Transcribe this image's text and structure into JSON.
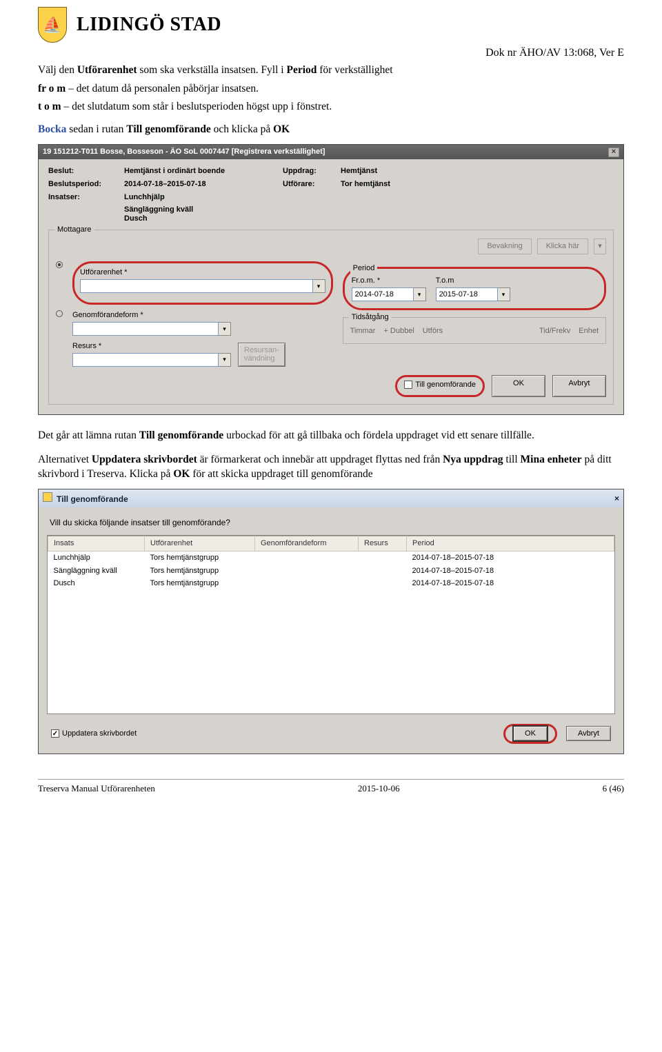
{
  "header": {
    "org": "LIDINGÖ STAD"
  },
  "docref": "Dok nr ÄHO/AV 13:068, Ver E",
  "intro": {
    "t1a": "Välj den ",
    "t1b": "Utförarenhet",
    "t1c": " som ska verkställa insatsen. Fyll i ",
    "t1d": "Period",
    "t1e": " för verkställighet",
    "t2a": "fr o m",
    "t2b": " – det datum då personalen påbörjar insatsen.",
    "t3a": "t o m",
    "t3b": " – det slutdatum som står i beslutsperioden högst upp i fönstret.",
    "t4a": "Bocka",
    "t4b": " sedan i rutan ",
    "t4c": "Till genomförande",
    "t4d": " och klicka på ",
    "t4e": "OK"
  },
  "win1": {
    "title": "19 151212-T011   Bosse, Bosseson   -   ÄO SoL   0007447   [Registrera verkställighet]",
    "labels": {
      "beslut": "Beslut:",
      "beslut_val": "Hemtjänst i ordinärt boende",
      "uppdrag": "Uppdrag:",
      "uppdrag_val": "Hemtjänst",
      "period": "Beslutsperiod:",
      "period_val": "2014-07-18–2015-07-18",
      "utforare": "Utförare:",
      "utforare_val": "Tor hemtjänst",
      "insatser": "Insatser:"
    },
    "insats_list": [
      "Lunchhjälp",
      "Sängläggning kväll",
      "Dusch"
    ],
    "group_mottagare": "Mottagare",
    "bevakning": "Bevakning",
    "klicka_har": "Klicka här",
    "utforarenhet": "Utförarenhet *",
    "genomform": "Genomförandeform *",
    "resurs": "Resurs *",
    "resursan": "Resursan-\nvändning",
    "group_period": "Period",
    "from": "Fr.o.m. *",
    "tom": "T.o.m",
    "from_val": "2014-07-18",
    "tom_val": "2015-07-18",
    "group_tids": "Tidsåtgång",
    "tids_cols": {
      "timmar": "Timmar",
      "dubbel": "+ Dubbel",
      "utfors": "Utförs",
      "tidfrekv": "Tid/Frekv",
      "enhet": "Enhet"
    },
    "till_genom": "Till genomförande",
    "ok": "OK",
    "avbryt": "Avbryt"
  },
  "mid": {
    "p1a": "Det går att lämna rutan ",
    "p1b": "Till genomförande",
    "p1c": " urbockad för att gå tillbaka och fördela uppdraget vid ett senare tillfälle.",
    "p2a": "Alternativet ",
    "p2b": "Uppdatera skrivbordet",
    "p2c": " är förmarkerat och innebär att uppdraget flyttas ned från ",
    "p2d": "Nya uppdrag",
    "p2e": " till ",
    "p2f": "Mina enheter",
    "p2g": " på ditt skrivbord i Treserva. Klicka på ",
    "p2h": "OK",
    "p2i": " för att skicka uppdraget till genomförande"
  },
  "win2": {
    "title": "Till genomförande",
    "prompt": "Vill du skicka följande insatser till genomförande?",
    "cols": {
      "insats": "Insats",
      "enhet": "Utförarenhet",
      "genom": "Genomförandeform",
      "resurs": "Resurs",
      "period": "Period"
    },
    "rows": [
      {
        "insats": "Lunchhjälp",
        "enhet": "Tors hemtjänstgrupp",
        "genom": "",
        "resurs": "",
        "period": "2014-07-18–2015-07-18"
      },
      {
        "insats": "Sängläggning kväll",
        "enhet": "Tors hemtjänstgrupp",
        "genom": "",
        "resurs": "",
        "period": "2014-07-18–2015-07-18"
      },
      {
        "insats": "Dusch",
        "enhet": "Tors hemtjänstgrupp",
        "genom": "",
        "resurs": "",
        "period": "2014-07-18–2015-07-18"
      }
    ],
    "update_chk": "Uppdatera skrivbordet",
    "ok": "OK",
    "avbryt": "Avbryt"
  },
  "footer": {
    "left": "Treserva Manual Utförarenheten",
    "mid": "2015-10-06",
    "right": "6 (46)"
  }
}
